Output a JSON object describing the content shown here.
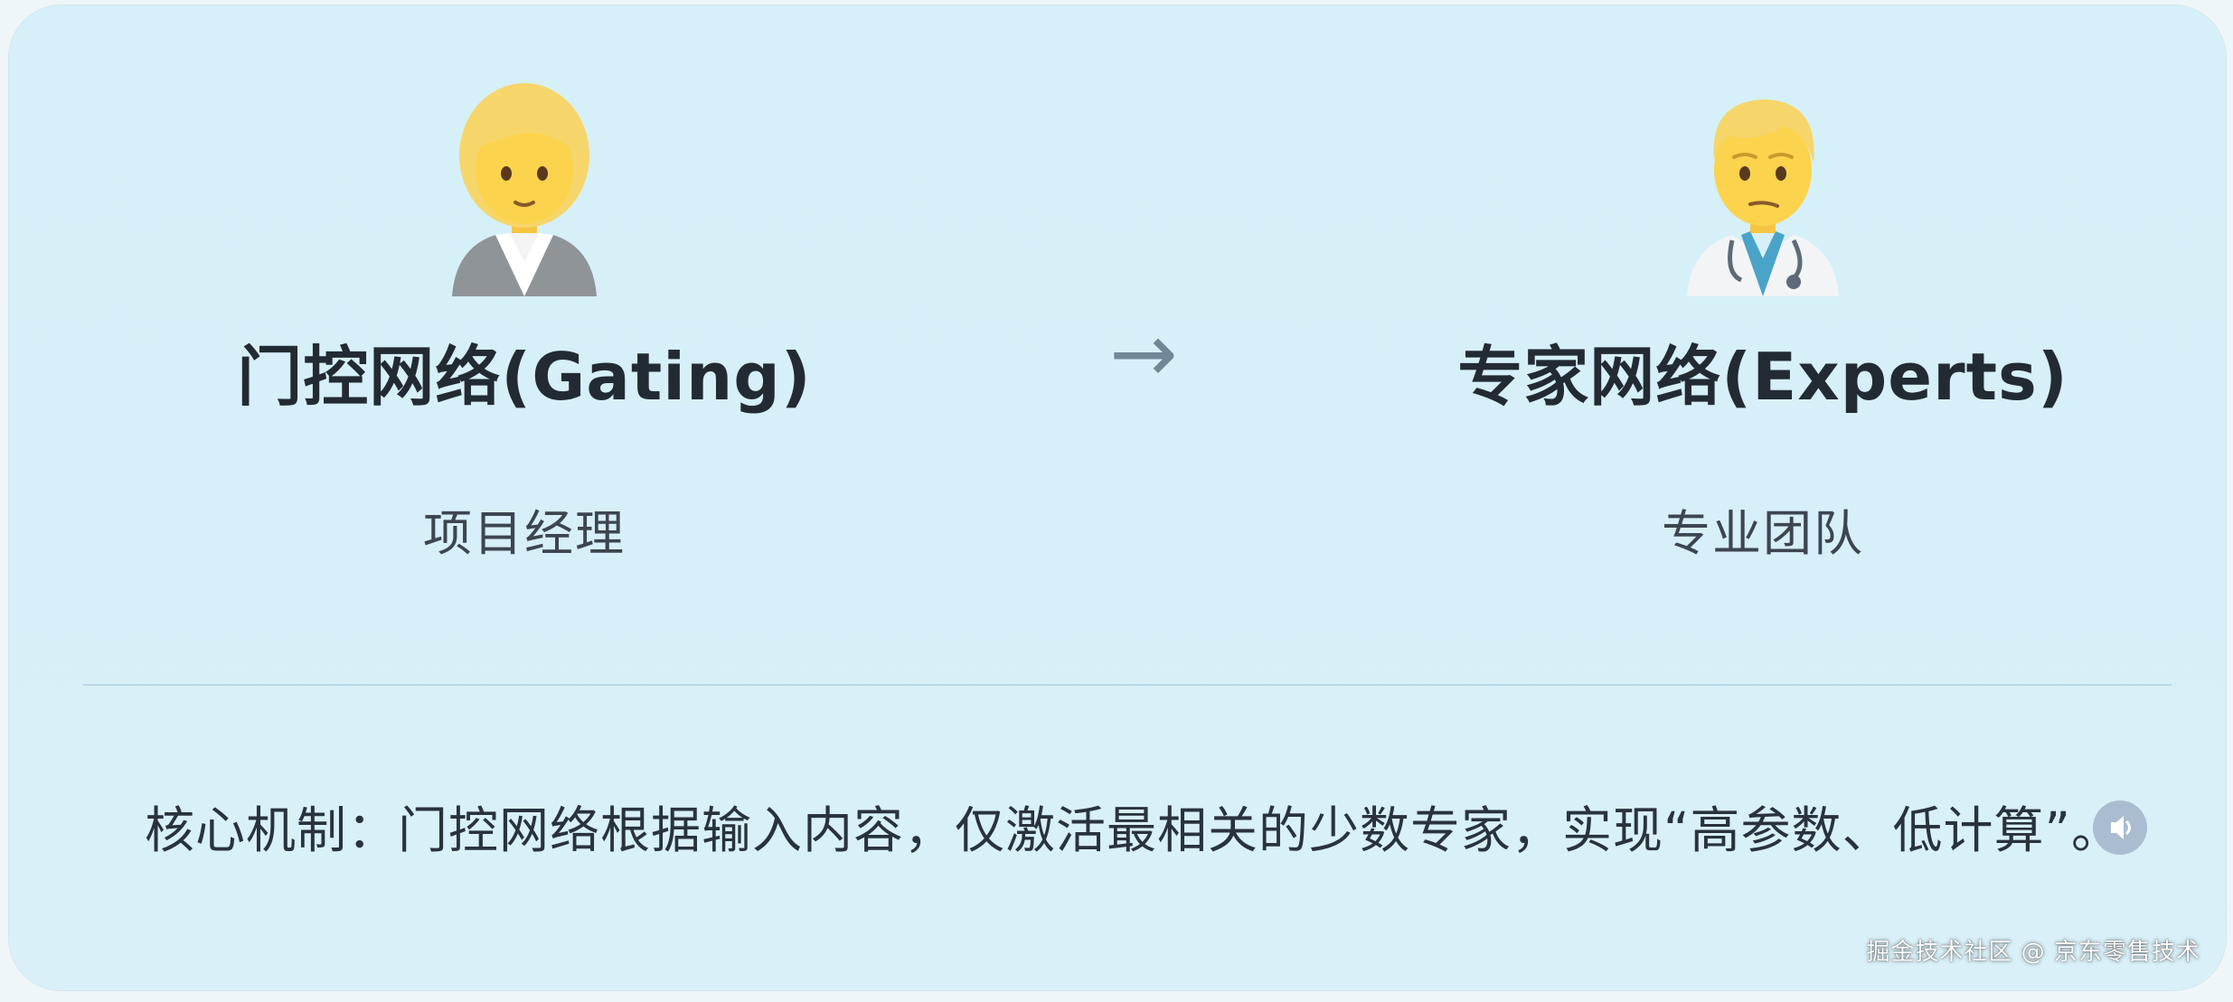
{
  "left_role": {
    "icon": "office-worker-emoji-icon",
    "title": "门控网络(Gating)",
    "subtitle": "项目经理"
  },
  "connector_arrow": "→",
  "right_role": {
    "icon": "health-worker-emoji-icon",
    "title": "专家网络(Experts)",
    "subtitle": "专业团队"
  },
  "mechanism_text": "核心机制：门控网络根据输入内容，仅激活最相关的少数专家，实现“高参数、低计算”。",
  "speaker_icon": "speaker-icon",
  "watermark": "掘金技术社区 @ 京东零售技术",
  "colors": {
    "card_background": "#d6eff9",
    "title_text": "#222b33",
    "arrow": "#6f8797",
    "divider": "#b9d9e7"
  }
}
